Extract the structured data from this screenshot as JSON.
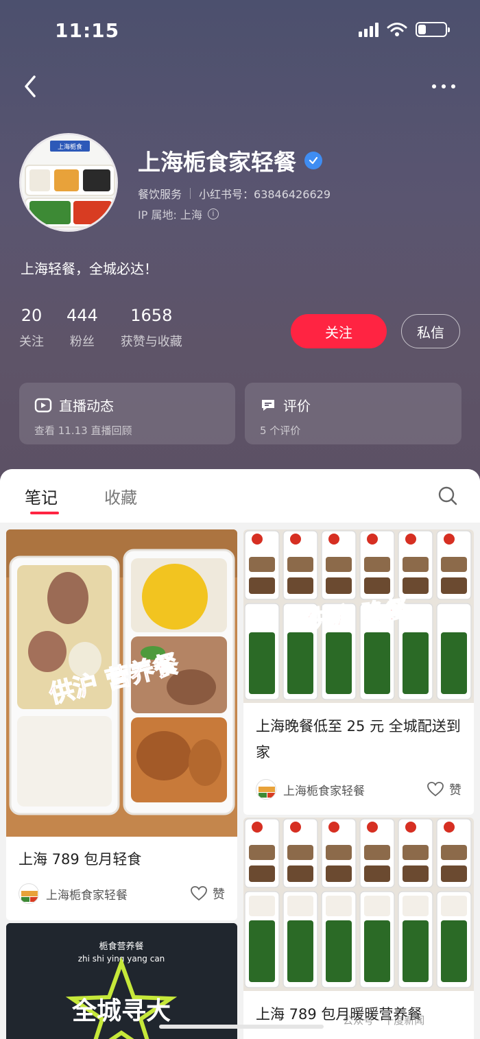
{
  "status_bar": {
    "time": "11:15",
    "battery_level": 0.28
  },
  "profile": {
    "name": "上海栀食家轻餐",
    "category": "餐饮服务",
    "account_label": "小红书号：63846426629",
    "ip_label": "IP 属地: 上海",
    "bio": "上海轻餐，全城必达！",
    "avatar_box_label": "上海栀食"
  },
  "stats": [
    {
      "value": "20",
      "label": "关注"
    },
    {
      "value": "444",
      "label": "粉丝"
    },
    {
      "value": "1658",
      "label": "获赞与收藏"
    }
  ],
  "actions": {
    "follow": "关注",
    "message": "私信"
  },
  "cards": [
    {
      "title": "直播动态",
      "subtitle": "查看 11.13 直播回顾"
    },
    {
      "title": "评价",
      "subtitle": "5 个评价"
    }
  ],
  "tabs": {
    "active": "笔记",
    "inactive": "收藏"
  },
  "notes": [
    {
      "title": "上海 789 包月轻食",
      "author": "上海栀食家轻餐",
      "like_label": "赞",
      "overlay": "供沪 营养餐"
    },
    {
      "title": "上海晚餐低至 25 元 全城配送到家",
      "author": "上海栀食家轻餐",
      "like_label": "赞",
      "overlay": "供沪 晚餐"
    },
    {
      "title": "",
      "author": "",
      "like_label": "",
      "overlay_top": "栀食营养餐",
      "overlay_sub": "zhi shi ying yang can",
      "overlay_main": "全城寻大"
    },
    {
      "title": "上海 789 包月暖暖营养餐",
      "author": "",
      "like_label": ""
    }
  ],
  "watermark": "公众号 · 十度新闻",
  "colors": {
    "accent": "#ff2442",
    "verified": "#3f8df2",
    "header_bg": "#55536e"
  },
  "icons": [
    "back-arrow-icon",
    "more-icon",
    "verified-icon",
    "info-icon",
    "live-icon",
    "comment-icon",
    "search-icon",
    "heart-icon"
  ]
}
